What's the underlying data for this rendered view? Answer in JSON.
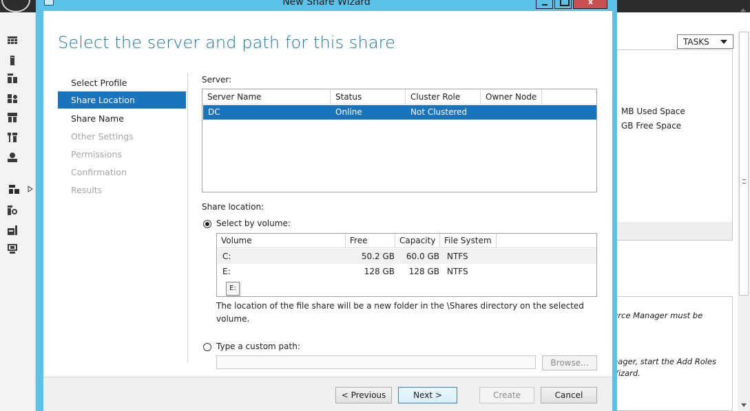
{
  "wizard": {
    "title": "New Share Wizard",
    "heading": "Select the server and path for this share",
    "steps": [
      {
        "label": "Select Profile",
        "state": "done"
      },
      {
        "label": "Share Location",
        "state": "current"
      },
      {
        "label": "Share Name",
        "state": "done"
      },
      {
        "label": "Other Settings",
        "state": "pending"
      },
      {
        "label": "Permissions",
        "state": "pending"
      },
      {
        "label": "Confirmation",
        "state": "pending"
      },
      {
        "label": "Results",
        "state": "pending"
      }
    ],
    "server": {
      "label": "Server:",
      "columns": [
        "Server Name",
        "Status",
        "Cluster Role",
        "Owner Node"
      ],
      "rows": [
        {
          "name": "DC",
          "status": "Online",
          "cluster_role": "Not Clustered",
          "owner_node": ""
        }
      ]
    },
    "share_location": {
      "label": "Share location:",
      "by_volume_label": "Select by volume:",
      "by_volume_selected": true,
      "volume_columns": [
        "Volume",
        "Free Space",
        "Capacity",
        "File System"
      ],
      "volumes": [
        {
          "volume": "C:",
          "free": "50.2 GB",
          "capacity": "60.0 GB",
          "fs": "NTFS"
        },
        {
          "volume": "E:",
          "free": "128 GB",
          "capacity": "128 GB",
          "fs": "NTFS"
        }
      ],
      "tooltip": "E:",
      "note": "The location of the file share will be a new folder in the \\Shares directory on the selected volume.",
      "custom_path_label": "Type a custom path:",
      "custom_path_value": "",
      "browse_label": "Browse..."
    },
    "buttons": {
      "previous": "< Previous",
      "next": "Next >",
      "create": "Create",
      "cancel": "Cancel"
    }
  },
  "server_manager": {
    "tasks_label": "TASKS",
    "used_space": "MB Used Space",
    "free_space": "GB Free Space",
    "message_line1": "urce Manager must be",
    "message_line2": "nager, start the Add Roles",
    "message_line3": "Vizard."
  },
  "colors": {
    "frame": "#5bc2e7",
    "selection": "#1a73bd",
    "heading": "#1a73a8"
  }
}
